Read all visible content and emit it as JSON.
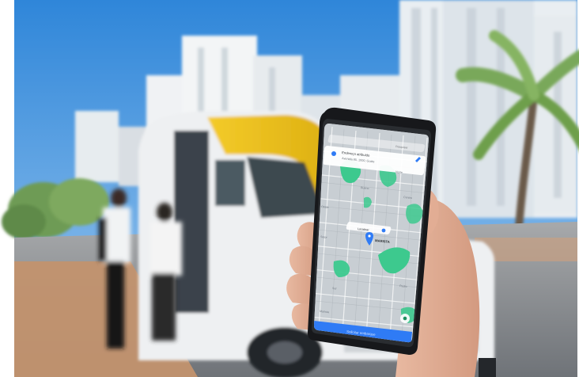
{
  "photo": {
    "colors": {
      "sky": "#5aa6e6",
      "van_yellow": "#f0c419",
      "van_white": "#eef0f2",
      "road": "#8e939a",
      "sidewalk": "#c2926e",
      "palm": "#7fae5d",
      "phone_body": "#1a1a1d"
    }
  },
  "phone": {
    "map": {
      "bg": "#c9ced3",
      "park": "#36c98b",
      "card_title": "Endereço atribuído",
      "card_subtitle": "Avenida 85, 1000, Goiás",
      "search_placeholder": "Pesquisar",
      "tag_left": "Localizar",
      "pin_label": "MARISTA",
      "place_label_1": "Bueno",
      "place_label_2": "Oeste",
      "place_label_3": "Centro",
      "place_label_4": "Sul",
      "place_label_5": "Norte",
      "place_label_6": "Setor",
      "place_label_7": "Pedro",
      "place_label_8": "Marista",
      "cta_label": "Solicitar embarque",
      "cta_color": "#2f7bf5"
    }
  }
}
